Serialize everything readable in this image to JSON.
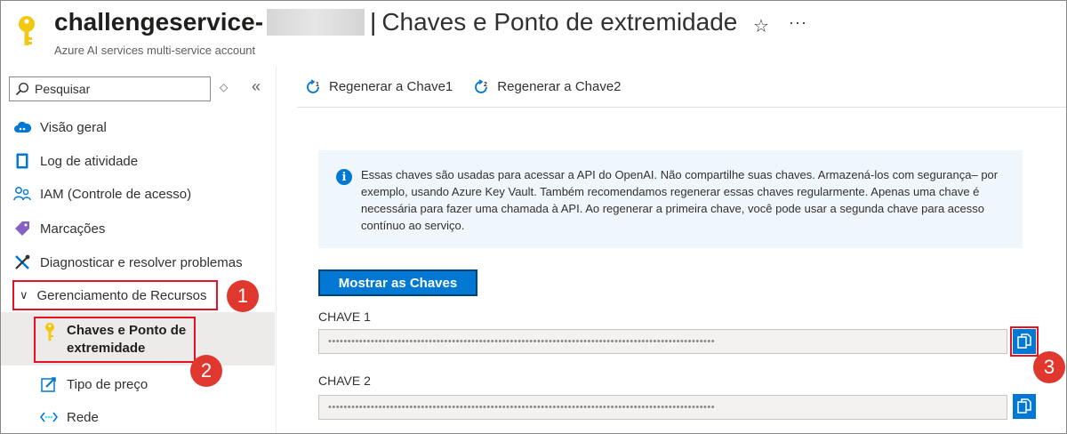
{
  "header": {
    "resource_name": "challengeservice-",
    "separator": "|",
    "page_name": "Chaves e Ponto de extremidade",
    "subtitle": "Azure AI services multi-service account",
    "star_glyph": "☆",
    "more_glyph": "···"
  },
  "sidebar": {
    "search_placeholder": "Pesquisar",
    "updown_glyph": "◇",
    "collapse_glyph": "«",
    "items": [
      {
        "label": "Visão geral",
        "icon": "cloud-ai-icon"
      },
      {
        "label": "Log de atividade",
        "icon": "activity-log-icon"
      },
      {
        "label": "IAM (Controle de acesso)",
        "icon": "people-icon"
      },
      {
        "label": "Marcações",
        "icon": "tag-icon"
      },
      {
        "label": "Diagnosticar e resolver problemas",
        "icon": "wrench-screwdriver-icon"
      }
    ],
    "group_chevron": "∨",
    "group": {
      "label": "Gerenciamento de Recursos",
      "expanded": true,
      "children": [
        {
          "label": "Chaves e Ponto de extremidade",
          "icon": "key-icon",
          "selected": true
        },
        {
          "label": "Tipo de preço",
          "icon": "edit-pricing-icon"
        },
        {
          "label": "Rede",
          "icon": "network-icon"
        }
      ]
    }
  },
  "toolbar": {
    "regen1": "Regenerar a Chave1",
    "regen2": "Regenerar a Chave2"
  },
  "info": {
    "icon_glyph": "i",
    "text": "Essas chaves são usadas para acessar a API do OpenAI. Não compartilhe suas chaves. Armazená-los com segurança– por exemplo, usando Azure Key Vault. Também recomendamos regenerar essas chaves regularmente. Apenas uma chave é necessária para fazer uma chamada à API. Ao regenerar a primeira chave, você pode usar a segunda chave para acesso contínuo ao serviço."
  },
  "keys": {
    "show_button": "Mostrar as Chaves",
    "items": [
      {
        "label": "CHAVE 1",
        "masked": "••••••••••••••••••••••••••••••••••••••••••••••••••••••••••••••••••••••••••••••••••••••••••••••••••••"
      },
      {
        "label": "CHAVE 2",
        "masked": "••••••••••••••••••••••••••••••••••••••••••••••••••••••••••••••••••••••••••••••••••••••••••••••••••••"
      }
    ]
  },
  "badges": [
    "1",
    "2",
    "3"
  ],
  "colors": {
    "accent": "#0078d4",
    "highlight": "#e81123",
    "badge": "#e0382f",
    "info_bg": "#eff6fc",
    "selected_bg": "#edebe9",
    "key_yellow": "#f2c811"
  }
}
